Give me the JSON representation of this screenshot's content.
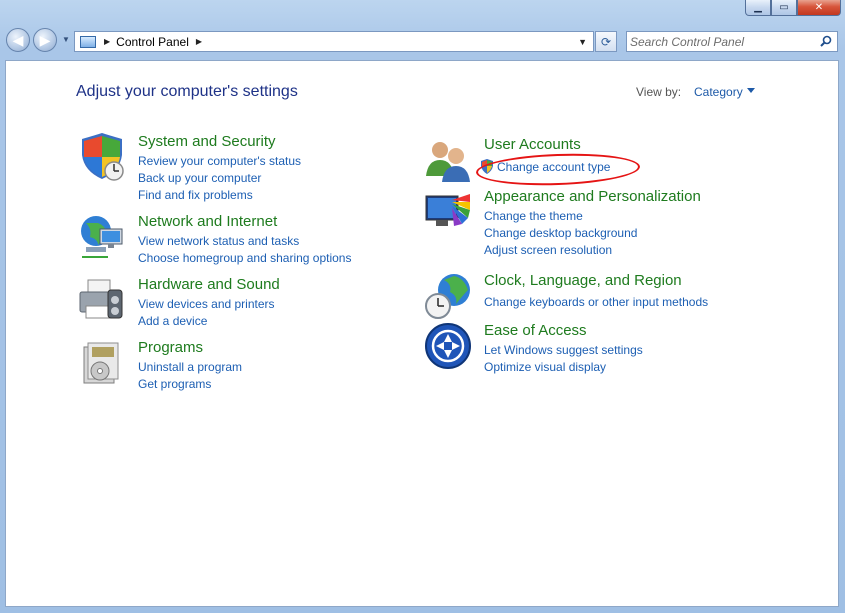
{
  "window": {
    "minimize": "▁",
    "maximize": "▭",
    "close": "✕"
  },
  "navigation": {
    "breadcrumb": [
      "Control Panel"
    ],
    "search_placeholder": "Search Control Panel"
  },
  "main": {
    "heading": "Adjust your computer's settings",
    "view_by_label": "View by:",
    "view_by_value": "Category"
  },
  "categories": {
    "system_security": {
      "title": "System and Security",
      "links": [
        "Review your computer's status",
        "Back up your computer",
        "Find and fix problems"
      ]
    },
    "network_internet": {
      "title": "Network and Internet",
      "links": [
        "View network status and tasks",
        "Choose homegroup and sharing options"
      ]
    },
    "hardware_sound": {
      "title": "Hardware and Sound",
      "links": [
        "View devices and printers",
        "Add a device"
      ]
    },
    "programs": {
      "title": "Programs",
      "links": [
        "Uninstall a program",
        "Get programs"
      ]
    },
    "user_accounts": {
      "title": "User Accounts",
      "links": [
        "Change account type"
      ]
    },
    "appearance": {
      "title": "Appearance and Personalization",
      "links": [
        "Change the theme",
        "Change desktop background",
        "Adjust screen resolution"
      ]
    },
    "clock_language": {
      "title": "Clock, Language, and Region",
      "links": [
        "Change keyboards or other input methods"
      ]
    },
    "ease_access": {
      "title": "Ease of Access",
      "links": [
        "Let Windows suggest settings",
        "Optimize visual display"
      ]
    }
  },
  "annotation": {
    "color": "#e51414"
  }
}
